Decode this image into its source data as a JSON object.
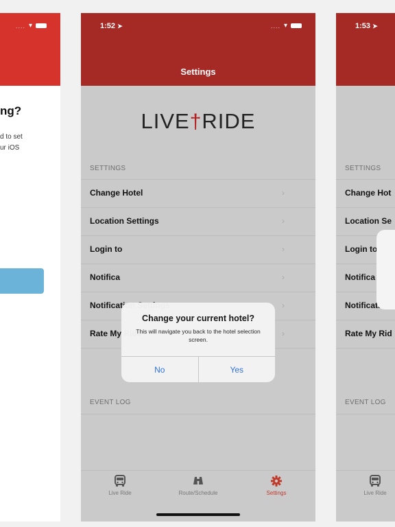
{
  "left_screen": {
    "question": "ng?",
    "desc_line1": "d to set",
    "desc_line2": "ur iOS"
  },
  "middle_screen": {
    "status_time": "1:52",
    "header_title": "Settings",
    "logo_left": "LIVE",
    "logo_mark": "†",
    "logo_right": "RIDE",
    "settings_header": "SETTINGS",
    "rows": [
      {
        "label": "Change Hotel"
      },
      {
        "label": "Location Settings"
      },
      {
        "label": "Login to"
      },
      {
        "label": "Notifica"
      },
      {
        "label": "Notification Settings"
      },
      {
        "label": "Rate My Ride"
      }
    ],
    "event_log_header": "EVENT LOG",
    "alert": {
      "title": "Change your current hotel?",
      "message": "This will navigate you back to the hotel selection screen.",
      "no": "No",
      "yes": "Yes"
    },
    "tabs": [
      {
        "label": "Live Ride",
        "icon": "bus-icon"
      },
      {
        "label": "Route/Schedule",
        "icon": "binoculars-icon"
      },
      {
        "label": "Settings",
        "icon": "gear-icon"
      }
    ]
  },
  "right_screen": {
    "status_time": "1:53",
    "settings_header": "SETTINGS",
    "rows": [
      {
        "label": "Change Hot"
      },
      {
        "label": "Location Se"
      },
      {
        "label": "Login to"
      },
      {
        "label": "Notifica"
      },
      {
        "label": "Notificati"
      },
      {
        "label": "Rate My Rid"
      }
    ],
    "event_log_header": "EVENT LOG",
    "tab_live": "Live Ride"
  },
  "colors": {
    "brand_red": "#a52a25",
    "active_tab": "#c0392b",
    "link_blue": "#2a6fe0",
    "button_blue": "#6bb3d9"
  }
}
